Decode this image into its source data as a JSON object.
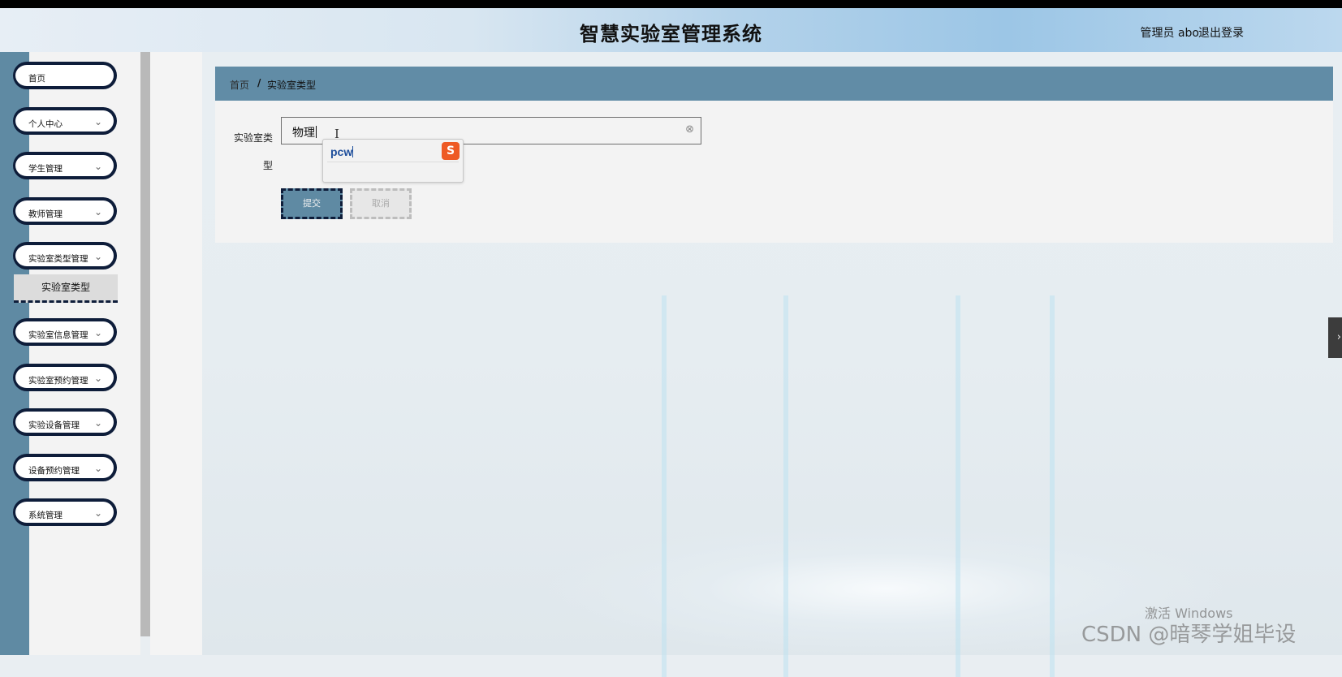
{
  "header": {
    "title": "智慧实验室管理系统",
    "user": "管理员 abo",
    "logout": "退出登录"
  },
  "sidebar": {
    "items": [
      {
        "label": "首页"
      },
      {
        "label": "个人中心"
      },
      {
        "label": "学生管理"
      },
      {
        "label": "教师管理"
      },
      {
        "label": "实验室类型管理"
      },
      {
        "label": "实验室信息管理"
      },
      {
        "label": "实验室预约管理"
      },
      {
        "label": "实验设备管理"
      },
      {
        "label": "设备预约管理"
      },
      {
        "label": "系统管理"
      }
    ],
    "chevron": "⌄",
    "active_sub": {
      "label": "实验室类型"
    }
  },
  "breadcrumb": {
    "home": "首页",
    "separator": "/",
    "current": "实验室类型"
  },
  "form": {
    "label": "实验室类型",
    "value": "物理",
    "clear_icon": "⊗",
    "ime": {
      "composition": "pcw",
      "logo": "S"
    },
    "submit": "提交",
    "cancel": "取消"
  },
  "side_toggle": "›",
  "watermarks": {
    "windows": "激活 Windows",
    "csdn": "CSDN @暗琴学姐毕设"
  },
  "colors": {
    "primary": "#5f8aa3",
    "dark_border": "#0e1d3a"
  }
}
